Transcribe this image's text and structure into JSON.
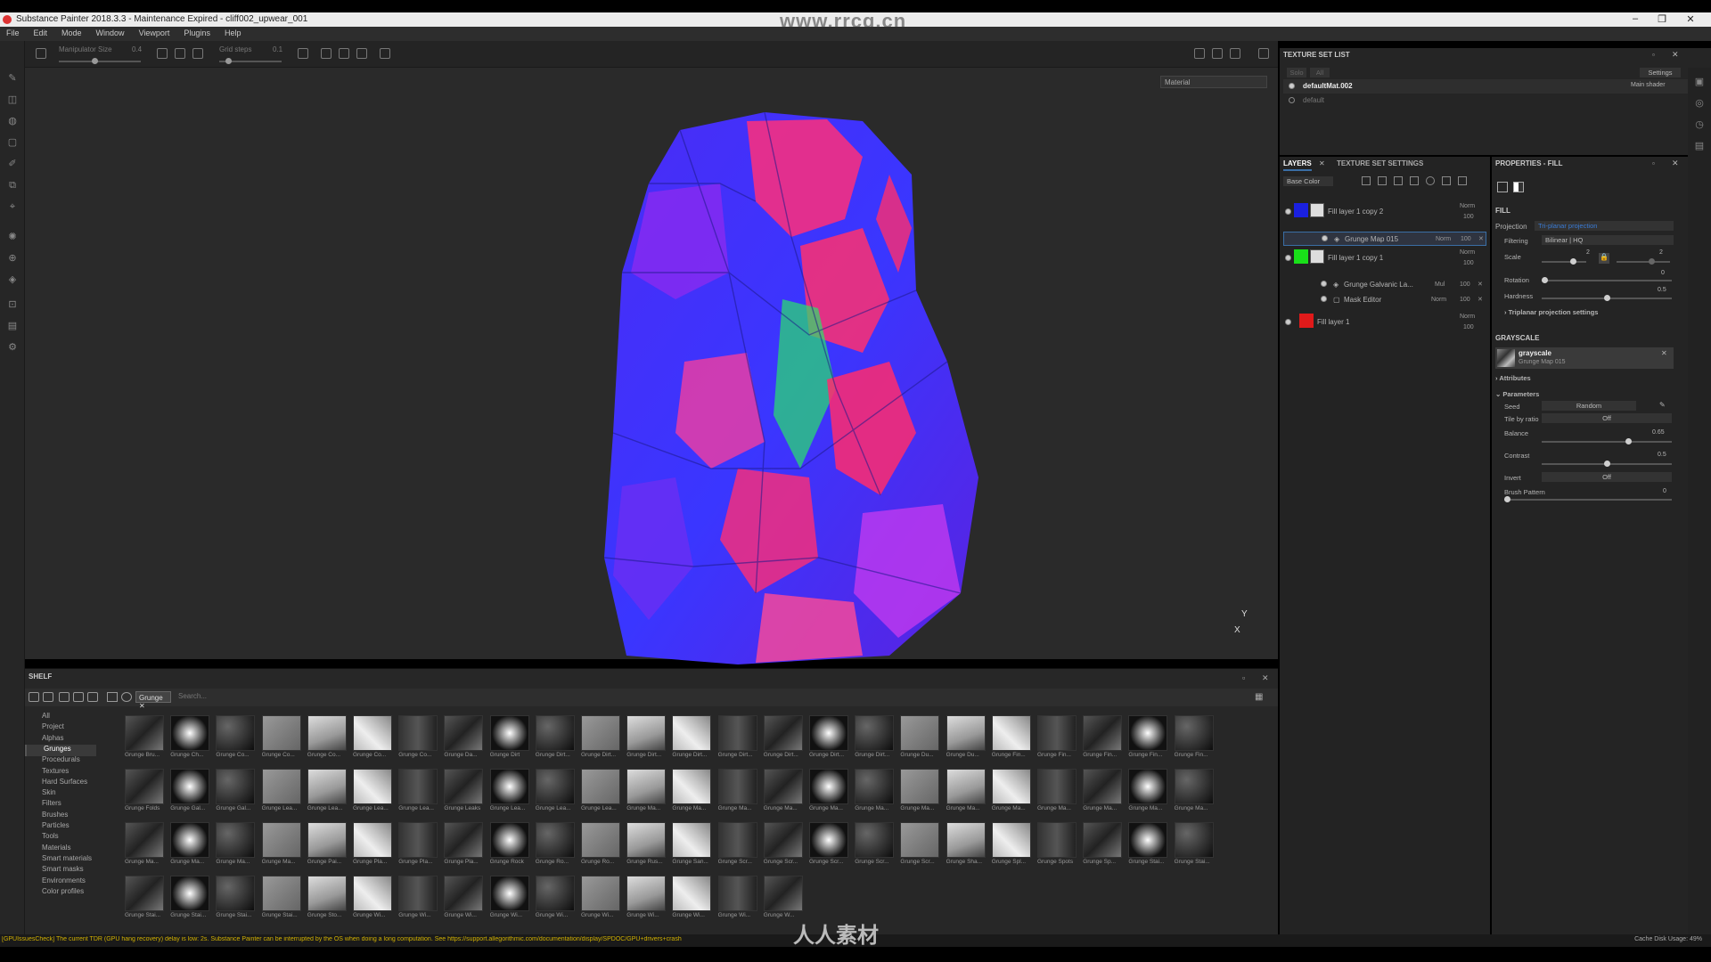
{
  "window": {
    "title": "Substance Painter 2018.3.3 - Maintenance Expired - cliff002_upwear_001"
  },
  "watermark_top": "www.rrcg.cn",
  "watermark_bottom": "人人素材",
  "menu": [
    "File",
    "Edit",
    "Mode",
    "Window",
    "Viewport",
    "Plugins",
    "Help"
  ],
  "toolbar": {
    "manipulator_label": "Manipulator Size",
    "manipulator_value": "0.4",
    "grid_label": "Grid steps",
    "grid_value": "0.1"
  },
  "viewport": {
    "material_select": "Material",
    "axis_y": "Y",
    "axis_x": "X"
  },
  "texture_set_list": {
    "title": "TEXTURE SET LIST",
    "settings": "Settings",
    "btn_solo": "Solo",
    "btn_all": "All",
    "sets": [
      {
        "name": "defaultMat.002",
        "shader": "Main shader"
      },
      {
        "name": "default"
      }
    ]
  },
  "layers_panel": {
    "tab_layers": "LAYERS",
    "tab_tss": "TEXTURE SET SETTINGS",
    "channel": "Base Color",
    "layers": [
      {
        "name": "Fill layer 1 copy 2",
        "blend": "Norm",
        "opacity": "100",
        "color": "#1a20e0",
        "effects": [
          {
            "name": "Grunge Map 015",
            "blend": "Norm",
            "opacity": "100"
          }
        ]
      },
      {
        "name": "Fill layer 1 copy 1",
        "blend": "Norm",
        "opacity": "100",
        "color": "#19e019",
        "effects": [
          {
            "name": "Grunge Galvanic La...",
            "blend": "Mul",
            "opacity": "100"
          },
          {
            "name": "Mask Editor",
            "blend": "Norm",
            "opacity": "100"
          }
        ]
      },
      {
        "name": "Fill layer 1",
        "blend": "Norm",
        "opacity": "100",
        "color": "#e01a1a",
        "effects": []
      }
    ]
  },
  "properties": {
    "title": "PROPERTIES - FILL",
    "fill_section": "FILL",
    "projection_label": "Projection",
    "projection_value": "Tri-planar projection",
    "filtering_label": "Filtering",
    "filtering_value": "Bilinear | HQ",
    "scale_label": "Scale",
    "scale_value": "2",
    "scale_value2": "2",
    "rotation_label": "Rotation",
    "rotation_value": "0",
    "hardness_label": "Hardness",
    "hardness_value": "0.5",
    "triplanar_settings": "Triplanar projection settings",
    "grayscale_section": "GRAYSCALE",
    "grayscale_name": "grayscale",
    "grayscale_resource": "Grunge Map 015",
    "attributes": "Attributes",
    "parameters": "Parameters",
    "seed_label": "Seed",
    "seed_value": "Random",
    "tile_label": "Tile by ratio",
    "tile_value": "Off",
    "balance_label": "Balance",
    "balance_value": "0.65",
    "contrast_label": "Contrast",
    "contrast_value": "0.5",
    "invert_label": "Invert",
    "invert_value": "Off",
    "brush_label": "Brush Pattern",
    "brush_value": "0"
  },
  "shelf": {
    "title": "SHELF",
    "filter_chip": "Grunge",
    "search_placeholder": "Search...",
    "categories": [
      "All",
      "Project",
      "Alphas",
      "Grunges",
      "Procedurals",
      "Textures",
      "Hard Surfaces",
      "Skin",
      "Filters",
      "Brushes",
      "Particles",
      "Tools",
      "Materials",
      "Smart materials",
      "Smart masks",
      "Environments",
      "Color profiles"
    ],
    "selected_category": "Grunges",
    "rows": [
      [
        "Grunge Bru...",
        "Grunge Ch...",
        "Grunge Co...",
        "Grunge Co...",
        "Grunge Co...",
        "Grunge Co...",
        "Grunge Co...",
        "Grunge Da...",
        "Grunge Dirt",
        "Grunge Dirt...",
        "Grunge Dirt...",
        "Grunge Dirt...",
        "Grunge Dirt...",
        "Grunge Dirt...",
        "Grunge Dirt...",
        "Grunge Dirt...",
        "Grunge Dirt...",
        "Grunge Du...",
        "Grunge Du...",
        "Grunge Fin...",
        "Grunge Fin...",
        "Grunge Fin...",
        "Grunge Fin...",
        "Grunge Fin..."
      ],
      [
        "Grunge Folds",
        "Grunge Gal...",
        "Grunge Gal...",
        "Grunge Lea...",
        "Grunge Lea...",
        "Grunge Lea...",
        "Grunge Lea...",
        "Grunge Leaks",
        "Grunge Lea...",
        "Grunge Lea...",
        "Grunge Lea...",
        "Grunge Ma...",
        "Grunge Ma...",
        "Grunge Ma...",
        "Grunge Ma...",
        "Grunge Ma...",
        "Grunge Ma...",
        "Grunge Ma...",
        "Grunge Ma...",
        "Grunge Ma...",
        "Grunge Ma...",
        "Grunge Ma...",
        "Grunge Ma...",
        "Grunge Ma..."
      ],
      [
        "Grunge Ma...",
        "Grunge Ma...",
        "Grunge Ma...",
        "Grunge Ma...",
        "Grunge Pai...",
        "Grunge Pla...",
        "Grunge Pla...",
        "Grunge Pla...",
        "Grunge Rock",
        "Grunge Ro...",
        "Grunge Ro...",
        "Grunge Rus...",
        "Grunge San...",
        "Grunge Scr...",
        "Grunge Scr...",
        "Grunge Scr...",
        "Grunge Scr...",
        "Grunge Scr...",
        "Grunge Sha...",
        "Grunge Spl...",
        "Grunge Spots",
        "Grunge Sp...",
        "Grunge Stai...",
        "Grunge Stai..."
      ],
      [
        "Grunge Stai...",
        "Grunge Stai...",
        "Grunge Stai...",
        "Grunge Stai...",
        "Grunge Sto...",
        "Grunge Wi...",
        "Grunge Wi...",
        "Grunge Wi...",
        "Grunge Wi...",
        "Grunge Wi...",
        "Grunge Wi...",
        "Grunge Wi...",
        "Grunge Wi...",
        "Grunge Wi...",
        "Grunge W..."
      ]
    ]
  },
  "status": {
    "message": "[GPUIssuesCheck] The current TDR (GPU hang recovery) delay is low: 2s. Substance Painter can be interrupted by the OS when doing a long computation. See https://support.allegorithmic.com/documentation/display/SPDOC/GPU+drivers+crash",
    "cache_label": "Cache Disk Usage:",
    "cache_value": "49%"
  }
}
